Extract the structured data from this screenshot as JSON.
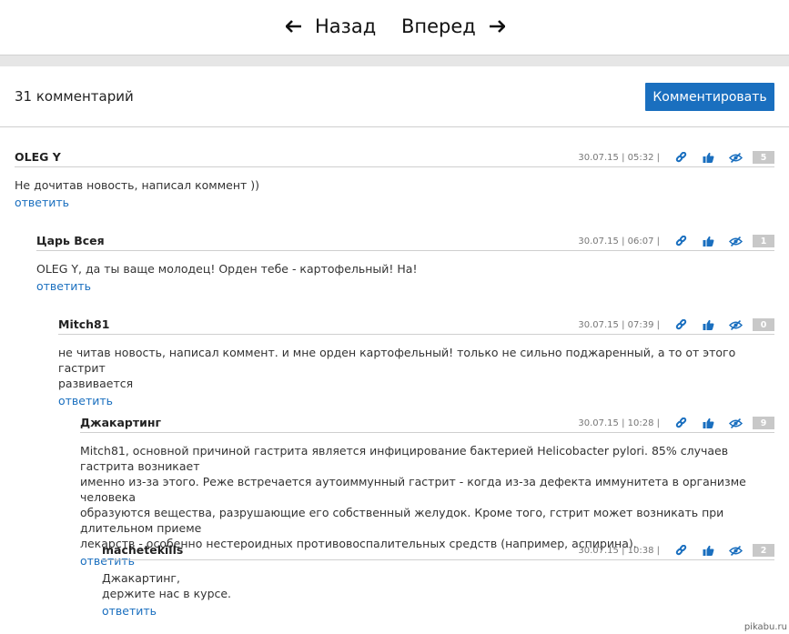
{
  "nav": {
    "back_label": "Назад",
    "forward_label": "Вперед"
  },
  "header": {
    "comment_count": "31 комментарий",
    "comment_button": "Комментировать"
  },
  "comments": [
    {
      "author": "OLEG Y",
      "date": "30.07.15 | 05:32 |",
      "rating": "5",
      "lines": [
        "Не дочитав новость, написал коммент ))"
      ],
      "reply": "ответить"
    },
    {
      "author": "Царь Всея",
      "date": "30.07.15 | 06:07 |",
      "rating": "1",
      "lines": [
        "OLEG Y, да ты ваще молодец! Орден тебе - картофельный! На!"
      ],
      "reply": "ответить"
    },
    {
      "author": "Mitch81",
      "date": "30.07.15 | 07:39 |",
      "rating": "0",
      "lines": [
        "не читав новость, написал коммент. и мне орден картофельный! только не сильно поджаренный, а то от этого гастрит",
        "развивается"
      ],
      "reply": "ответить"
    },
    {
      "author": "Джакартинг",
      "date": "30.07.15 | 10:28 |",
      "rating": "9",
      "lines": [
        "Mitch81, основной причиной гастрита является инфицирование бактерией Helicobacter pylori. 85% случаев гастрита возникает",
        "именно из-за этого. Реже встречается аутоиммунный гастрит - когда из-за дефекта иммунитета в организме человека",
        "образуются вещества, разрушающие его собственный желудок. Кроме того, гстрит может возникать при длительном приеме",
        "лекарств - особенно нестероидных противовоспалительных средств (например, аспирина)."
      ],
      "reply": "ответить"
    },
    {
      "author": "machetekills",
      "date": "30.07.15 | 10:38 |",
      "rating": "2",
      "lines": [
        "Джакартинг,",
        "держите нас в курсе."
      ],
      "reply": "ответить"
    }
  ],
  "icons": [
    "arrow-left-icon",
    "arrow-right-icon",
    "link-icon",
    "thumbs-up-icon",
    "hide-eye-icon"
  ],
  "colors": {
    "accent": "#1a6fbf",
    "rating_bg": "#c8c8c8"
  },
  "watermark": "pikabu.ru"
}
